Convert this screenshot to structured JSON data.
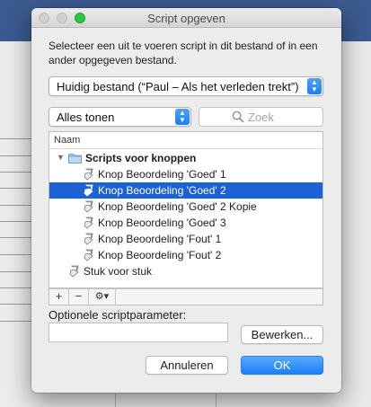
{
  "dialog": {
    "title": "Script opgeven",
    "description": "Selecteer een uit te voeren script in dit bestand of in een ander opgegeven bestand.",
    "file_select": "Huidig bestand (“Paul – Als het verleden trekt”)",
    "filter_select": "Alles tonen",
    "search_placeholder": "Zoek",
    "list": {
      "column_header": "Naam",
      "folder": "Scripts voor knoppen",
      "items": [
        {
          "label": "Knop Beoordeling 'Goed' 1",
          "selected": false
        },
        {
          "label": "Knop Beoordeling 'Goed' 2",
          "selected": true
        },
        {
          "label": "Knop Beoordeling 'Goed' 2 Kopie",
          "selected": false
        },
        {
          "label": "Knop Beoordeling 'Goed' 3",
          "selected": false
        },
        {
          "label": "Knop Beoordeling 'Fout' 1",
          "selected": false
        },
        {
          "label": "Knop Beoordeling 'Fout' 2",
          "selected": false
        }
      ],
      "root_item": "Stuk voor stuk"
    },
    "footer": {
      "add": "+",
      "remove": "−",
      "gear": "⚙▾"
    },
    "param_label": "Optionele scriptparameter:",
    "param_value": "",
    "edit_button": "Bewerken...",
    "cancel_button": "Annuleren",
    "ok_button": "OK"
  },
  "colors": {
    "selection": "#1c62d6",
    "accent_button": "#1b7ff6",
    "zoom_button": "#2bc840"
  }
}
